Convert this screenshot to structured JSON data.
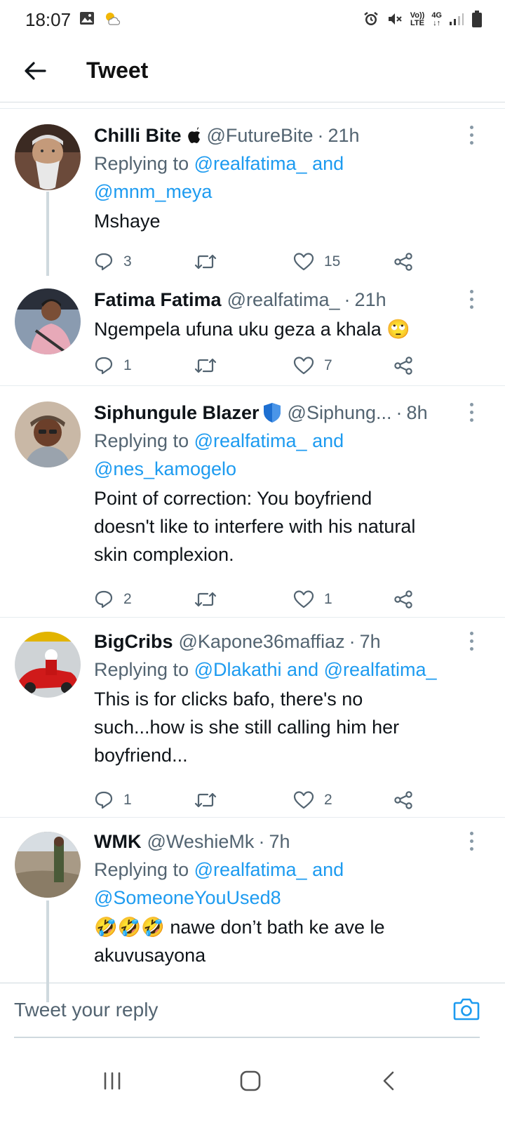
{
  "status_bar": {
    "time": "18:07",
    "icons": [
      "gallery-icon",
      "weather-icon",
      "alarm-icon",
      "mute-icon",
      "volte-icon",
      "4g-icon",
      "signal-icon",
      "battery-icon"
    ],
    "volte_top": "Vo))",
    "volte_bottom": "LTE",
    "net_top": "4G",
    "net_bottom": "↓↑"
  },
  "header": {
    "title": "Tweet"
  },
  "tweets": [
    {
      "name": "Chilli Bite",
      "name_badge": "apple-icon",
      "handle": "@FutureBite",
      "time": "21h",
      "replying_prefix": "Replying to ",
      "replying_line1": "@realfatima_ and",
      "replying_line2": "@mnm_meya",
      "text": "Mshaye",
      "replies": "3",
      "likes": "15"
    },
    {
      "name": "Fatima Fatima",
      "handle": "@realfatima_",
      "time": "21h",
      "text": "Ngempela ufuna uku geza a khala",
      "emoji": "🙄",
      "replies": "1",
      "likes": "7"
    },
    {
      "name": "Siphungule Blazer",
      "name_badge": "shield-icon",
      "handle": "@Siphung...",
      "time": "8h",
      "replying_prefix": "Replying to ",
      "replying_line1": "@realfatima_ and",
      "replying_line2": "@nes_kamogelo",
      "text_lines": [
        "Point of correction: You boyfriend",
        "doesn't like to interfere with his natural",
        "skin complexion."
      ],
      "replies": "2",
      "likes": "1"
    },
    {
      "name": "BigCribs",
      "handle": "@Kapone36maffiaz",
      "time": "7h",
      "replying_prefix": "Replying to ",
      "replying_line1": "@Dlakathi and @realfatima_",
      "text_lines": [
        "This is for clicks bafo, there's no",
        "such...how is she still calling him her",
        "boyfriend..."
      ],
      "replies": "1",
      "likes": "2"
    },
    {
      "name": "WMK",
      "handle": "@WeshieMk",
      "time": "7h",
      "replying_prefix": "Replying to ",
      "replying_line1": "@realfatima_ and",
      "replying_line2": "@SomeoneYouUsed8",
      "emoji": "🤣🤣🤣",
      "text_line1": " nawe don’t bath ke ave le",
      "text_line2": "akuvusayona"
    }
  ],
  "reply_bar": {
    "placeholder": "Tweet your reply"
  },
  "nav": {
    "recent": "recent-apps-icon",
    "home": "home-icon",
    "back": "back-icon"
  }
}
